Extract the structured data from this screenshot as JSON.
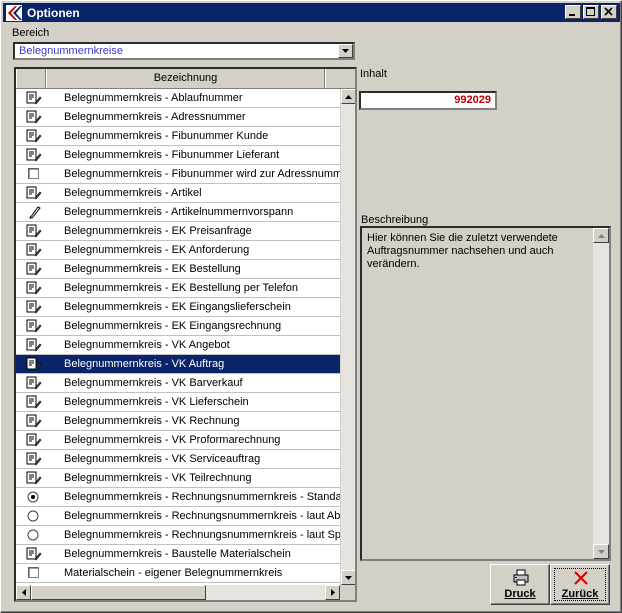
{
  "window": {
    "title": "Optionen"
  },
  "bereich": {
    "label": "Bereich",
    "selected": "Belegnummernkreise"
  },
  "list": {
    "column_header": "Bezeichnung",
    "selected_index": 14,
    "items": [
      {
        "label": "Belegnummernkreis - Ablaufnummer",
        "icon": "edit-doc-icon"
      },
      {
        "label": "Belegnummernkreis - Adressnummer",
        "icon": "edit-doc-icon"
      },
      {
        "label": "Belegnummernkreis - Fibunummer Kunde",
        "icon": "edit-doc-icon"
      },
      {
        "label": "Belegnummernkreis - Fibunummer Lieferant",
        "icon": "edit-doc-icon"
      },
      {
        "label": "Belegnummernkreis - Fibunummer wird zur Adressnummer",
        "icon": "checkbox-icon"
      },
      {
        "label": "Belegnummernkreis - Artikel",
        "icon": "edit-doc-icon"
      },
      {
        "label": "Belegnummernkreis - Artikelnummernvorspann",
        "icon": "pen-icon"
      },
      {
        "label": "Belegnummernkreis - EK Preisanfrage",
        "icon": "edit-doc-icon"
      },
      {
        "label": "Belegnummernkreis - EK Anforderung",
        "icon": "edit-doc-icon"
      },
      {
        "label": "Belegnummernkreis - EK Bestellung",
        "icon": "edit-doc-icon"
      },
      {
        "label": "Belegnummernkreis - EK Bestellung per Telefon",
        "icon": "edit-doc-icon"
      },
      {
        "label": "Belegnummernkreis - EK Eingangslieferschein",
        "icon": "edit-doc-icon"
      },
      {
        "label": "Belegnummernkreis - EK Eingangsrechnung",
        "icon": "edit-doc-icon"
      },
      {
        "label": "Belegnummernkreis - VK Angebot",
        "icon": "edit-doc-icon"
      },
      {
        "label": "Belegnummernkreis - VK Auftrag",
        "icon": "edit-doc-icon"
      },
      {
        "label": "Belegnummernkreis - VK Barverkauf",
        "icon": "edit-doc-icon"
      },
      {
        "label": "Belegnummernkreis - VK Lieferschein",
        "icon": "edit-doc-icon"
      },
      {
        "label": "Belegnummernkreis - VK Rechnung",
        "icon": "edit-doc-icon"
      },
      {
        "label": "Belegnummernkreis - VK Proformarechnung",
        "icon": "edit-doc-icon"
      },
      {
        "label": "Belegnummernkreis - VK Serviceauftrag",
        "icon": "edit-doc-icon"
      },
      {
        "label": "Belegnummernkreis - VK Teilrechnung",
        "icon": "edit-doc-icon"
      },
      {
        "label": "Belegnummernkreis - Rechnungsnummernkreis - Standard",
        "icon": "radio-checked-icon"
      },
      {
        "label": "Belegnummernkreis - Rechnungsnummernkreis - laut Abrechnung",
        "icon": "radio-icon"
      },
      {
        "label": "Belegnummernkreis - Rechnungsnummernkreis - laut Sparte",
        "icon": "radio-icon"
      },
      {
        "label": "Belegnummernkreis - Baustelle Materialschein",
        "icon": "edit-doc-icon"
      },
      {
        "label": "Materialschein - eigener Belegnummernkreis",
        "icon": "checkbox-icon"
      }
    ]
  },
  "inhalt": {
    "label": "Inhalt",
    "value": "992029"
  },
  "beschreibung": {
    "label": "Beschreibung",
    "text": "Hier können Sie die zuletzt verwendete Auftragsnummer nachsehen und auch verändern."
  },
  "buttons": {
    "druck": "Druck",
    "zurueck": "Zurück"
  },
  "colors": {
    "title_bar": "#0a246a",
    "value_red": "#c00000",
    "combo_text": "#3a3ac8"
  }
}
